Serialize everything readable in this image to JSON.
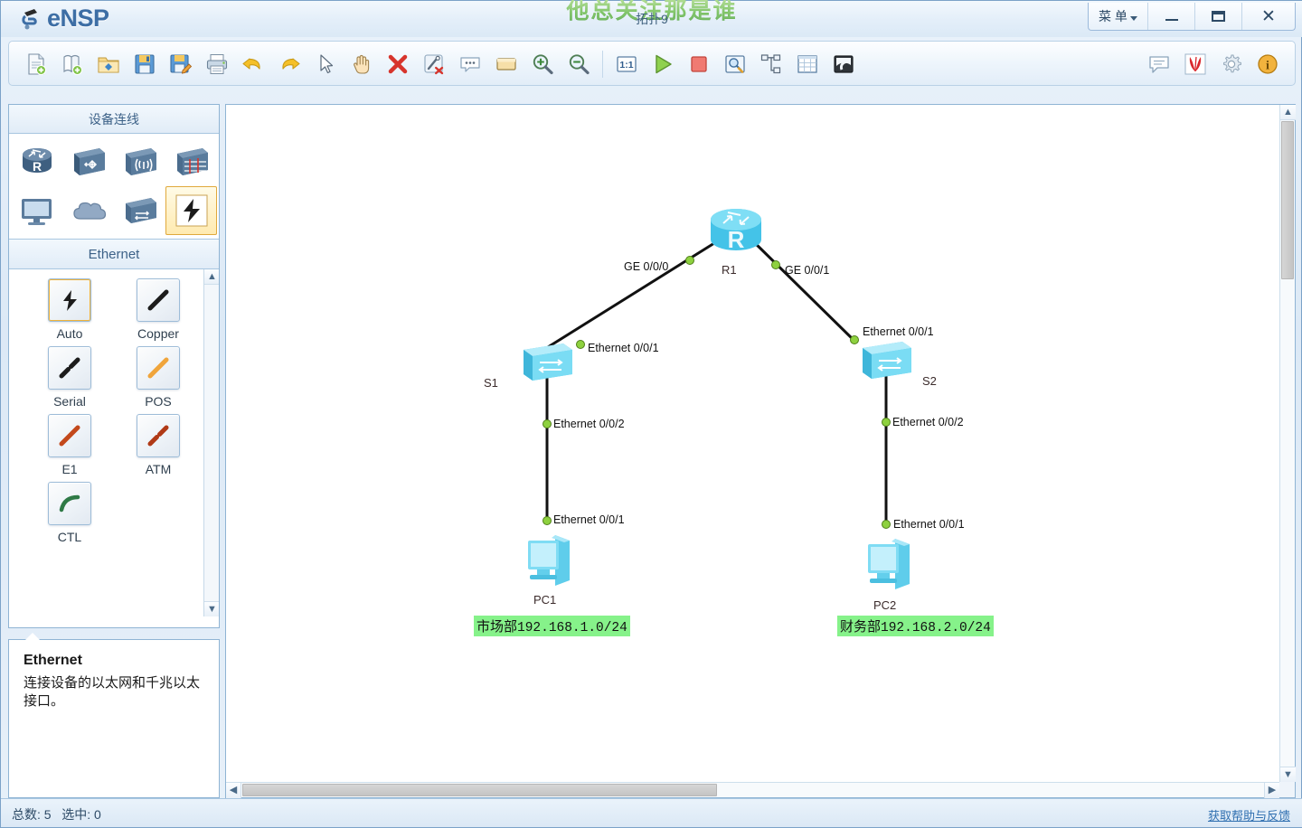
{
  "window": {
    "app_name": "eNSP",
    "title": "拓扑9",
    "watermark": "他总关注那是谁",
    "menu_label": "菜 单",
    "minimize_label": "",
    "maximize_label": "",
    "close_label": "✕"
  },
  "toolbar": {
    "left_buttons": [
      {
        "name": "new-topology-icon",
        "tip": "新建拓扑"
      },
      {
        "name": "new-from-template-icon",
        "tip": "新建试卷工程"
      },
      {
        "name": "open-folder-icon",
        "tip": "打开"
      },
      {
        "name": "save-icon",
        "tip": "保存"
      },
      {
        "name": "save-as-icon",
        "tip": "另存为"
      },
      {
        "name": "print-icon",
        "tip": "打印"
      },
      {
        "name": "undo-icon",
        "tip": "撤销"
      },
      {
        "name": "redo-icon",
        "tip": "恢复"
      },
      {
        "name": "select-pointer-icon",
        "tip": "选择"
      },
      {
        "name": "hand-pan-icon",
        "tip": "移动"
      },
      {
        "name": "delete-icon",
        "tip": "删除"
      },
      {
        "name": "delete-link-icon",
        "tip": "删除连线"
      },
      {
        "name": "add-note-icon",
        "tip": "添加描述"
      },
      {
        "name": "add-shape-icon",
        "tip": "添加图形"
      },
      {
        "name": "zoom-in-icon",
        "tip": "放大"
      },
      {
        "name": "zoom-out-icon",
        "tip": "缩小"
      }
    ],
    "run_buttons": [
      {
        "name": "actual-size-icon",
        "tip": "1:1"
      },
      {
        "name": "start-all-icon",
        "tip": "开启设备"
      },
      {
        "name": "stop-all-icon",
        "tip": "关闭设备"
      },
      {
        "name": "capture-packet-icon",
        "tip": "数据抓包"
      },
      {
        "name": "topology-tree-icon",
        "tip": "拓扑树"
      },
      {
        "name": "grid-icon",
        "tip": "网格"
      },
      {
        "name": "minimap-icon",
        "tip": "缩略图"
      }
    ],
    "right_buttons": [
      {
        "name": "comment-icon",
        "tip": "留言"
      },
      {
        "name": "huawei-logo-icon",
        "tip": "华为"
      },
      {
        "name": "settings-gear-icon",
        "tip": "设置"
      },
      {
        "name": "help-about-icon",
        "tip": "帮助"
      }
    ]
  },
  "sidebar": {
    "header": "设备连线",
    "device_rows": [
      [
        {
          "name": "router-icon",
          "label": "路由器",
          "selected": false
        },
        {
          "name": "switch-icon",
          "label": "交换机",
          "selected": false
        },
        {
          "name": "wlan-icon",
          "label": "无线局域网",
          "selected": false
        },
        {
          "name": "firewall-icon",
          "label": "防火墙",
          "selected": false
        }
      ],
      [
        {
          "name": "endpoint-icon",
          "label": "终端",
          "selected": false
        },
        {
          "name": "cloud-icon",
          "label": "其他设备",
          "selected": false
        },
        {
          "name": "device-stack-icon",
          "label": "设备",
          "selected": false
        },
        {
          "name": "connection-icon",
          "label": "连线",
          "selected": true
        }
      ]
    ],
    "subheader": "Ethernet",
    "cables": [
      {
        "name": "cable-auto",
        "label": "Auto",
        "selected": true
      },
      {
        "name": "cable-copper",
        "label": "Copper",
        "selected": false
      },
      {
        "name": "cable-serial",
        "label": "Serial",
        "selected": false
      },
      {
        "name": "cable-pos",
        "label": "POS",
        "selected": false
      },
      {
        "name": "cable-e1",
        "label": "E1",
        "selected": false
      },
      {
        "name": "cable-atm",
        "label": "ATM",
        "selected": false
      },
      {
        "name": "cable-ctl",
        "label": "CTL",
        "selected": false
      }
    ]
  },
  "description": {
    "title": "Ethernet",
    "body": "连接设备的以太网和千兆以太接口。"
  },
  "topology": {
    "nodes": [
      {
        "id": "R1",
        "type": "router",
        "label": "R1"
      },
      {
        "id": "S1",
        "type": "switch",
        "label": "S1"
      },
      {
        "id": "S2",
        "type": "switch",
        "label": "S2"
      },
      {
        "id": "PC1",
        "type": "pc",
        "label": "PC1"
      },
      {
        "id": "PC2",
        "type": "pc",
        "label": "PC2"
      }
    ],
    "interface_labels": [
      {
        "id": "r1-ge000",
        "text": "GE 0/0/0"
      },
      {
        "id": "r1-ge001",
        "text": "GE 0/0/1"
      },
      {
        "id": "s1-eth001",
        "text": "Ethernet 0/0/1"
      },
      {
        "id": "s2-eth001",
        "text": "Ethernet 0/0/1"
      },
      {
        "id": "s1-eth002",
        "text": "Ethernet 0/0/2"
      },
      {
        "id": "s2-eth002",
        "text": "Ethernet 0/0/2"
      },
      {
        "id": "pc1-eth001",
        "text": "Ethernet 0/0/1"
      },
      {
        "id": "pc2-eth001",
        "text": "Ethernet 0/0/1"
      }
    ],
    "net_tags": [
      {
        "id": "tag-market",
        "dept": "市场部",
        "cidr": "192.168.1.0/24"
      },
      {
        "id": "tag-finance",
        "dept": "财务部",
        "cidr": "192.168.2.0/24"
      }
    ]
  },
  "statusbar": {
    "total_label": "总数:",
    "total_value": "5",
    "selected_label": "选中:",
    "selected_value": "0",
    "help_link": "获取帮助与反馈"
  },
  "colors": {
    "accent": "#3d6ea5",
    "tag_green": "#86f28a",
    "link_green": "#7ed321",
    "device_cyan": "#6fd8f5"
  }
}
